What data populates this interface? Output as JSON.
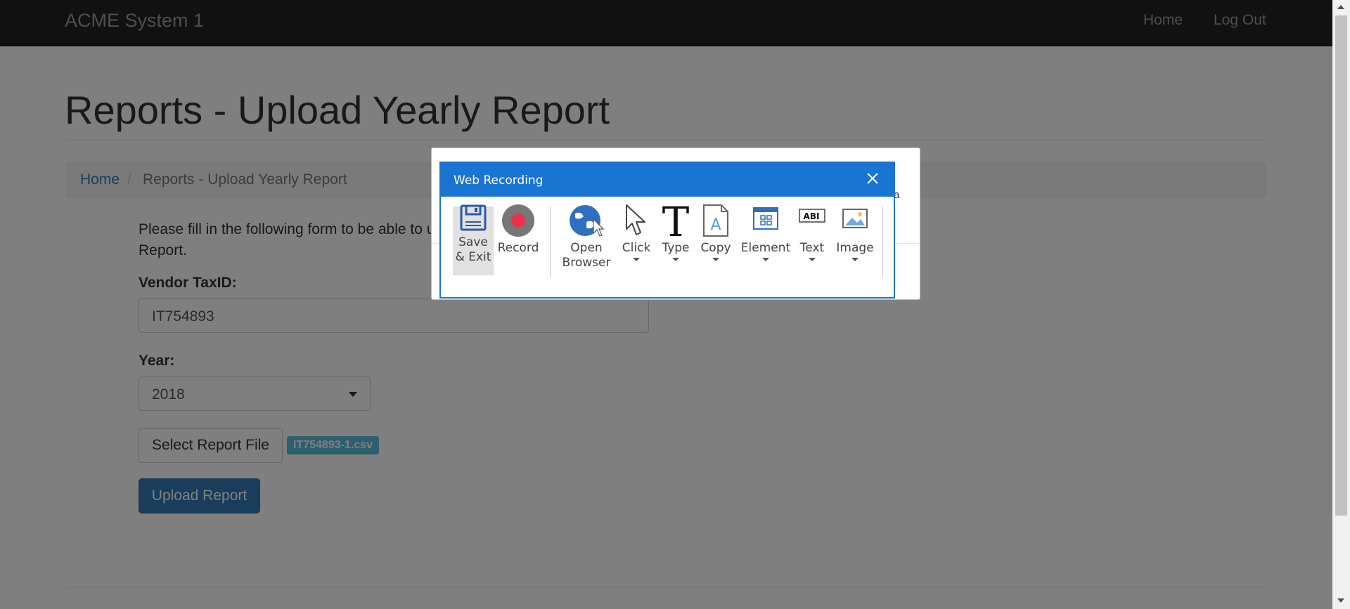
{
  "navbar": {
    "brand": "ACME System 1",
    "home": "Home",
    "logout": "Log Out"
  },
  "page": {
    "title": "Reports - Upload Yearly Report",
    "breadcrumb": {
      "home": "Home",
      "separator": "/",
      "current": "Reports - Upload Yearly Report"
    },
    "intro_line1": "Please fill in the following form to be able to u",
    "intro_line2": "Report."
  },
  "form": {
    "taxid_label": "Vendor TaxID:",
    "taxid_value": "IT754893",
    "year_label": "Year:",
    "year_value": "2018",
    "select_file_label": "Select Report File",
    "file_name": "IT754893-1.csv",
    "upload_label": "Upload Report"
  },
  "modal": {
    "fragment": "a"
  },
  "recorder": {
    "title": "Web Recording",
    "tools": {
      "save_line1": "Save",
      "save_line2": "& Exit",
      "record": "Record",
      "open_line1": "Open",
      "open_line2": "Browser",
      "click": "Click",
      "type": "Type",
      "copy": "Copy",
      "element": "Element",
      "text": "Text",
      "text_icon": "ABI",
      "image": "Image"
    }
  },
  "colors": {
    "navbar": "#222222",
    "link": "#337ab7",
    "primary_button": "#337ab7",
    "badge": "#5bc0de",
    "recorder_header": "#1a74d2",
    "record_dot": "#e8334a"
  },
  "icons": {
    "save": "floppy-disk-icon",
    "record": "record-icon",
    "open_browser": "globe-cursor-icon",
    "click": "mouse-pointer-icon",
    "type": "letter-t-icon",
    "copy": "document-a-icon",
    "element": "element-grid-icon",
    "text": "text-field-icon",
    "image": "image-icon",
    "close": "close-icon"
  }
}
